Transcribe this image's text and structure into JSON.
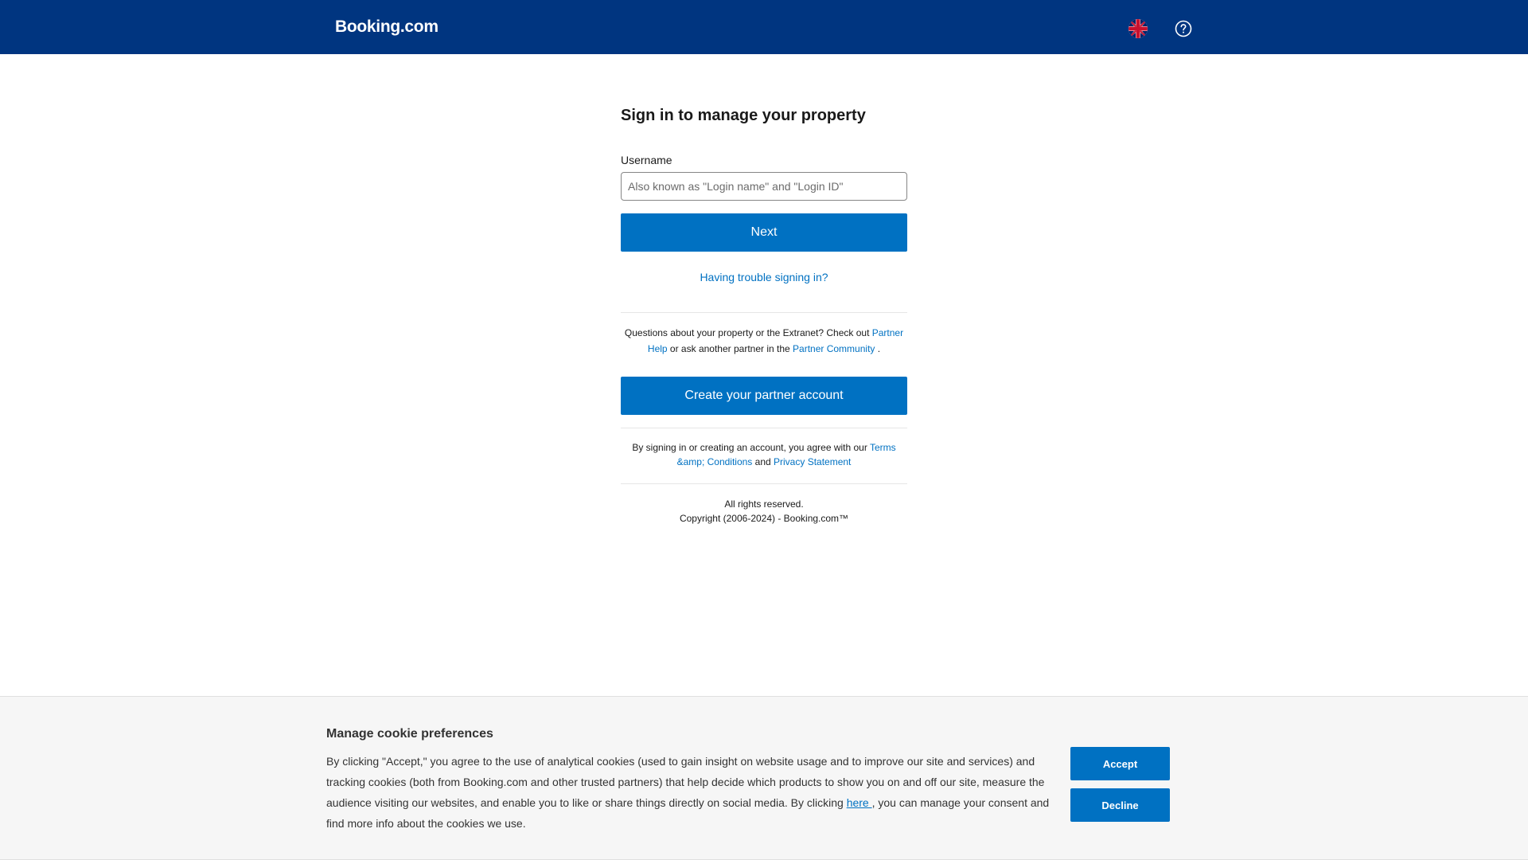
{
  "header": {
    "logo": "Booking.com",
    "language_icon": "uk-flag-icon",
    "help_icon": "question-circle-icon",
    "background_color": "#003580"
  },
  "signin": {
    "title": "Sign in to manage your property",
    "username_label": "Username",
    "username_value": "",
    "username_placeholder": "Also known as \"Login name\" and \"Login ID\"",
    "next_button": "Next",
    "trouble_link": "Having trouble signing in?",
    "questions": {
      "text1": "Questions about your property or the Extranet? Check out ",
      "link1": "Partner Help",
      "text2": " or ask another partner in the ",
      "link2": "Partner Community",
      "text3": " ."
    },
    "create_button": "Create your partner account",
    "terms": {
      "text1": "By signing in or creating an account, you agree with our ",
      "link1": "Terms &amp; Conditions",
      "text2": " and ",
      "link2": "Privacy Statement"
    },
    "rights": "All rights reserved.",
    "copyright": "Copyright (2006-2024) - Booking.com™",
    "accent_color": "#0071c2"
  },
  "cookie": {
    "title": "Manage cookie preferences",
    "text1": "By clicking \"Accept,\" you agree to the use of analytical cookies (used to gain insight on website usage and to improve our site and services) and tracking cookies (both from Booking.com and other trusted partners) that help decide which products to show you on and off our site, measure the audience visiting our websites, and enable you to like or share things directly on social media. By clicking ",
    "link": "here ",
    "text2": ", you can manage your consent and find more info about the cookies we use.",
    "accept_button": "Accept",
    "decline_button": "Decline"
  }
}
